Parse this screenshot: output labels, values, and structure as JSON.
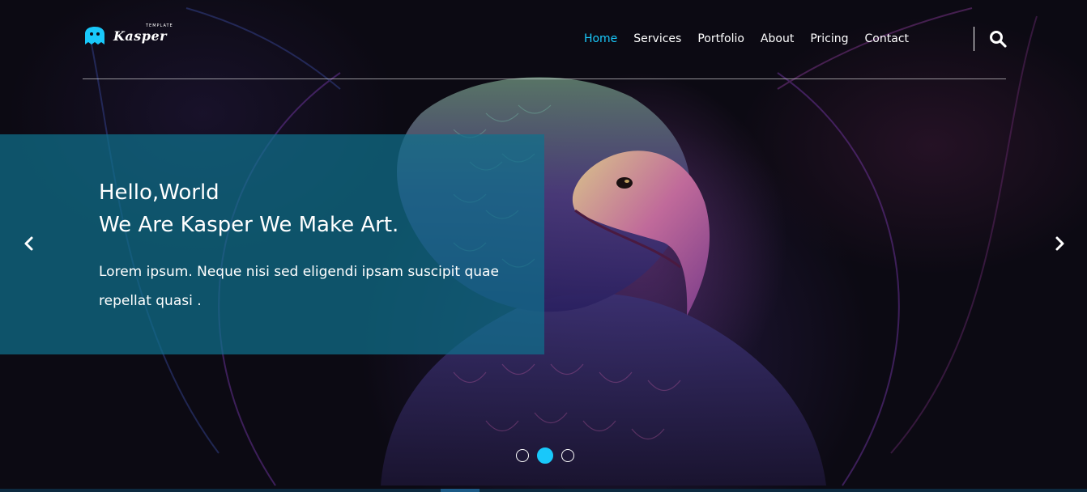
{
  "header": {
    "logo": {
      "name": "Kasper",
      "tagline": "TEMPLATE"
    },
    "nav": [
      {
        "label": "Home",
        "active": true
      },
      {
        "label": "Services",
        "active": false
      },
      {
        "label": "Portfolio",
        "active": false
      },
      {
        "label": "About",
        "active": false
      },
      {
        "label": "Pricing",
        "active": false
      },
      {
        "label": "Contact",
        "active": false
      }
    ],
    "search_icon": "search-icon"
  },
  "slider": {
    "heading_line1": "Hello,World",
    "heading_line2": "We Are Kasper We Make Art.",
    "text": "Lorem ipsum. Neque nisi sed eligendi ipsam suscipit quae repellat quasi .",
    "prev_icon": "chevron-left-icon",
    "next_icon": "chevron-right-icon",
    "bullets": [
      false,
      true,
      false
    ]
  },
  "colors": {
    "accent": "#19c8fa",
    "panel": "#0f708c"
  }
}
